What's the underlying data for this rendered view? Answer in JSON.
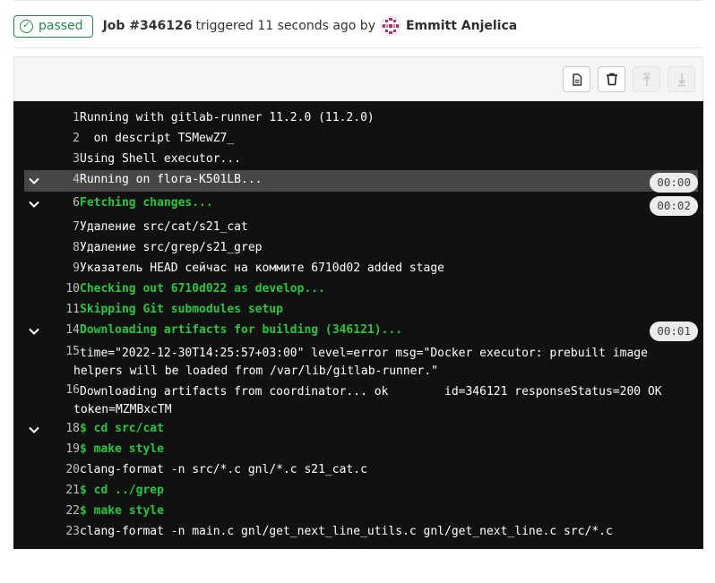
{
  "header": {
    "status": "passed",
    "job_id": "Job #346126",
    "triggered_text": "triggered 11 seconds ago by",
    "user_name": "Emmitt Anjelica"
  },
  "toolbar": {
    "buttons": [
      {
        "name": "show-raw",
        "icon": "file-text-icon",
        "enabled": true
      },
      {
        "name": "erase-log",
        "icon": "trash-icon",
        "enabled": true
      },
      {
        "name": "scroll-to-top",
        "icon": "arrow-up-icon",
        "enabled": false
      },
      {
        "name": "scroll-to-bottom",
        "icon": "arrow-down-icon",
        "enabled": false
      }
    ]
  },
  "colors": {
    "passed": "#1f8a4c",
    "log_background": "#111111",
    "section_header": "#26c83d",
    "highlight_row": "#474747"
  },
  "log_lines": [
    {
      "num": "1",
      "text": "Running with gitlab-runner 11.2.0 (11.2.0)"
    },
    {
      "num": "2",
      "text": "  on descript TSMewZ7_"
    },
    {
      "num": "3",
      "text": "Using Shell executor..."
    },
    {
      "num": "4",
      "text": "Running on flora-K501LB...",
      "duration": "00:00"
    },
    {
      "num": "6",
      "text": "Fetching changes...",
      "duration": "00:02"
    },
    {
      "num": "7",
      "text": "Удаление src/cat/s21_cat"
    },
    {
      "num": "8",
      "text": "Удаление src/grep/s21_grep"
    },
    {
      "num": "9",
      "text": "Указатель HEAD сейчас на коммите 6710d02 added stage"
    },
    {
      "num": "10",
      "text": "Checking out 6710d022 as develop..."
    },
    {
      "num": "11",
      "text": "Skipping Git submodules setup"
    },
    {
      "num": "14",
      "text": "Downloading artifacts for building (346121)...",
      "duration": "00:01"
    },
    {
      "num": "15",
      "text": "time=\"2022-12-30T14:25:57+03:00\" level=error msg=\"Docker executor: prebuilt image helpers will be loaded from /var/lib/gitlab-runner.\""
    },
    {
      "num": "16",
      "text": "Downloading artifacts from coordinator... ok        id=346121 responseStatus=200 OK token=MZMBxcTM"
    },
    {
      "num": "18",
      "text": "$ cd src/cat"
    },
    {
      "num": "19",
      "text": "$ make style"
    },
    {
      "num": "20",
      "text": "clang-format -n src/*.c gnl/*.c s21_cat.c"
    },
    {
      "num": "21",
      "text": "$ cd ../grep"
    },
    {
      "num": "22",
      "text": "$ make style"
    },
    {
      "num": "23",
      "text": "clang-format -n main.c gnl/get_next_line_utils.c gnl/get_next_line.c src/*.c"
    }
  ]
}
